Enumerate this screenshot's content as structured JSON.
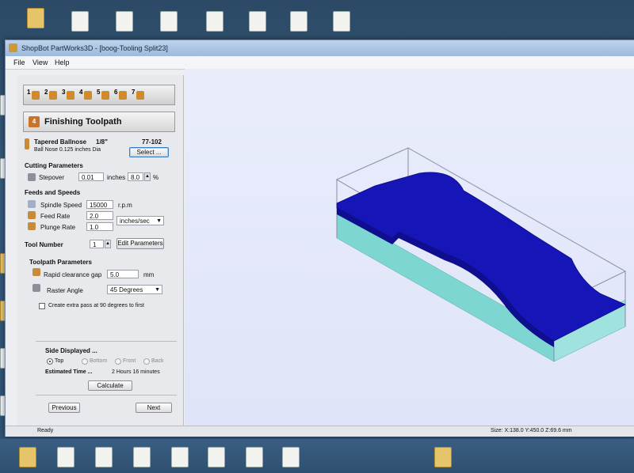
{
  "window": {
    "title": "ShopBot PartWorks3D - [boog-Tooling Split23]"
  },
  "menu": [
    "File",
    "View",
    "Help"
  ],
  "steps": [
    "1",
    "2",
    "3",
    "4",
    "5",
    "6",
    "7"
  ],
  "step_banner": {
    "number": "4",
    "title": "Finishing Toolpath"
  },
  "tool": {
    "name": "Tapered Ballnose",
    "size": "1/8\"",
    "code": "77-102",
    "desc": "Ball Nose 0.125 inches Dia",
    "select_label": "Select ..."
  },
  "cutting": {
    "header": "Cutting Parameters",
    "stepover_label": "Stepover",
    "stepover_value": "0.01",
    "stepover_unit": "inches",
    "percent_value": "8.0",
    "percent_unit": "%"
  },
  "feeds": {
    "header": "Feeds and Speeds",
    "spindle_label": "Spindle Speed",
    "spindle_value": "15000",
    "spindle_unit": "r.p.m",
    "feed_label": "Feed Rate",
    "feed_value": "2.0",
    "feed_unit": "inches/sec",
    "plunge_label": "Plunge Rate",
    "plunge_value": "1.0"
  },
  "toolnum": {
    "label": "Tool Number",
    "value": "1",
    "edit_label": "Edit Parameters"
  },
  "toolpath": {
    "header": "Toolpath Parameters",
    "clearance_label": "Rapid clearance gap",
    "clearance_value": "5.0",
    "clearance_unit": "mm",
    "raster_label": "Raster Angle",
    "raster_value": "45 Degrees",
    "extra_pass_label": "Create extra pass at 90 degrees to first"
  },
  "side": {
    "header": "Side Displayed ...",
    "options": [
      "Top",
      "Bottom",
      "Front",
      "Back"
    ],
    "estimated_label": "Estimated Time ...",
    "estimated_value": "2 Hours 16 minutes",
    "calculate_label": "Calculate"
  },
  "nav": {
    "previous": "Previous",
    "next": "Next"
  },
  "status": {
    "left": "Ready",
    "size": "Size: X:138.0 Y:450.0 Z:69.6 mm"
  },
  "colors": {
    "model_top": "#1414b4",
    "model_side": "#0c0c8a",
    "stock_side": "#7ed6d2",
    "viewport_bg": "#e6eafa"
  }
}
